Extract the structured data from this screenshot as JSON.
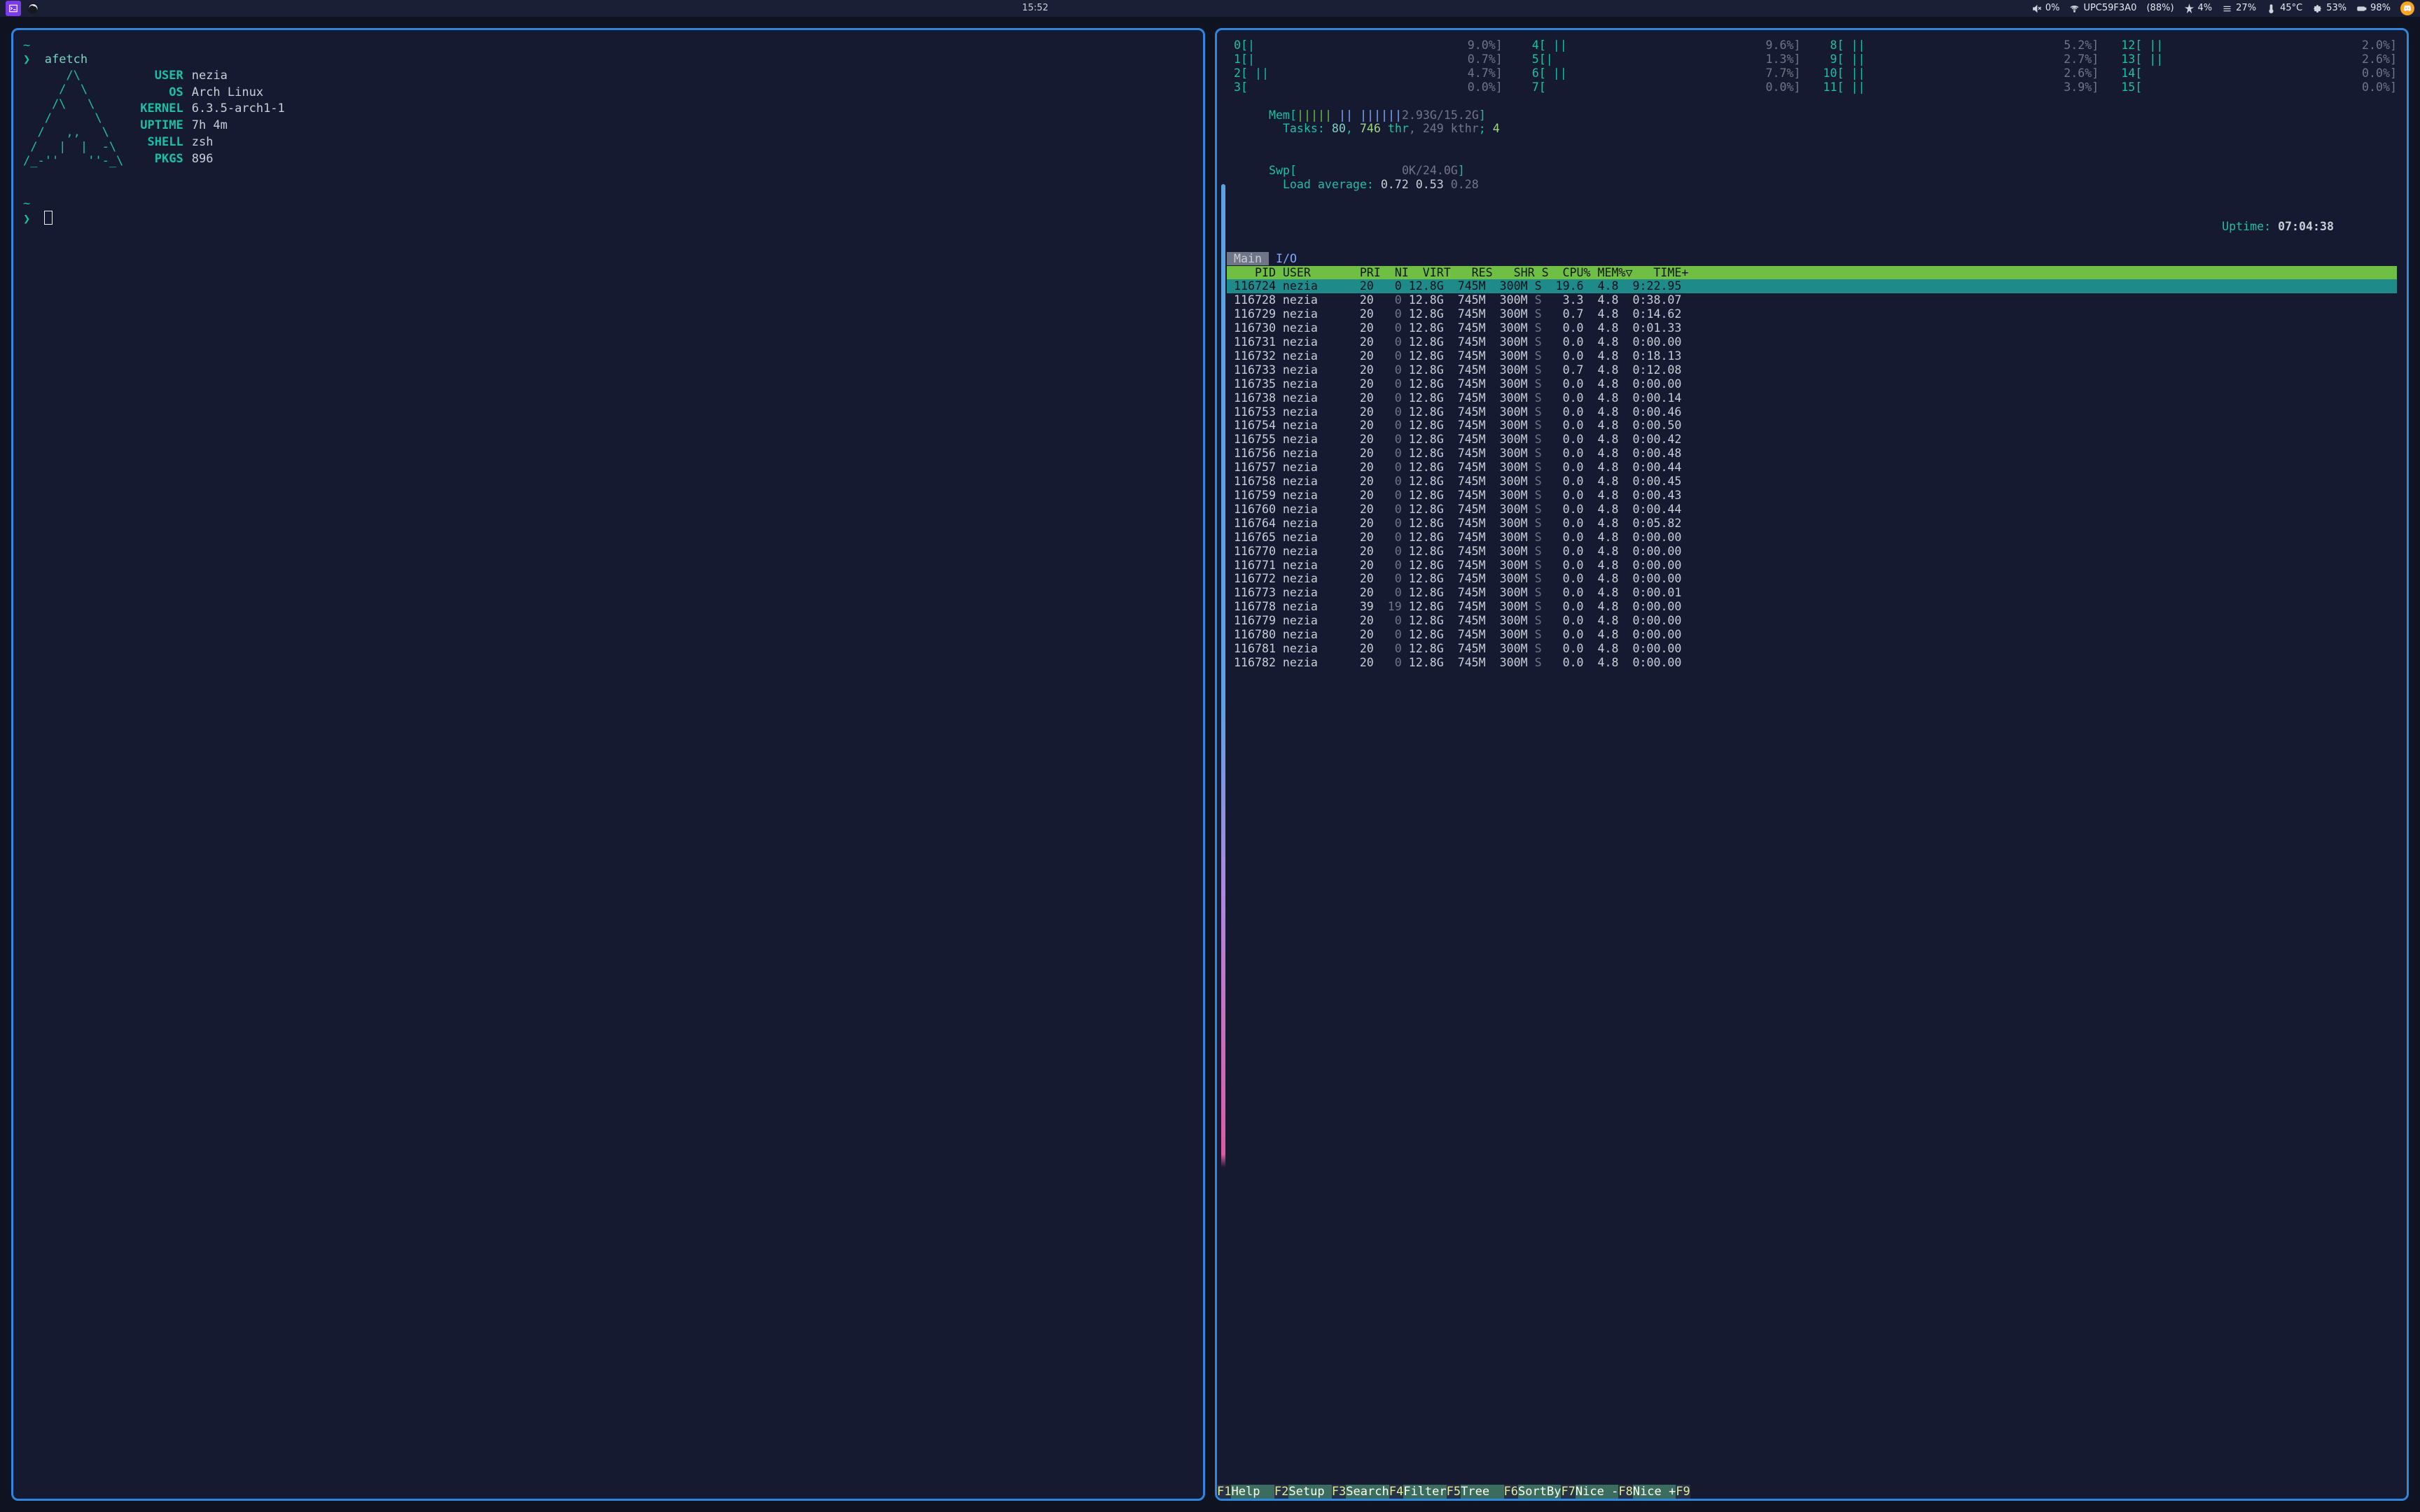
{
  "taskbar": {
    "time": "15:52",
    "volume": {
      "pct": "0%"
    },
    "wifi": {
      "ssid": "UPC59F3A0",
      "signal": "(88%)"
    },
    "notify": {
      "pct": "4%"
    },
    "hamburger": {
      "pct": "27%"
    },
    "thermo": {
      "temp": "45°C"
    },
    "gear": {
      "pct": "53%"
    },
    "battery": {
      "pct": "98%"
    }
  },
  "left_terminal": {
    "prompt_char": "❯",
    "tilde": "~",
    "cmd": "afetch",
    "logo": "      /\\\n     /  \\\n    /\\   \\\n   /      \\\n  /   ,,   \\\n /   |  |  -\\\n/_-''    ''-_\\",
    "rows": [
      {
        "k": "USER",
        "v": "nezia"
      },
      {
        "k": "OS",
        "v": "Arch Linux"
      },
      {
        "k": "KERNEL",
        "v": "6.3.5-arch1-1"
      },
      {
        "k": "UPTIME",
        "v": "7h 4m"
      },
      {
        "k": "SHELL",
        "v": "zsh"
      },
      {
        "k": "PKGS",
        "v": "896"
      }
    ]
  },
  "htop": {
    "cpus": [
      {
        "i": "0",
        "bar": "[|",
        "pct": "9.0%]"
      },
      {
        "i": "1",
        "bar": "[|",
        "pct": "0.7%]"
      },
      {
        "i": "2",
        "bar": "[ ||",
        "pct": "4.7%]"
      },
      {
        "i": "3",
        "bar": "[",
        "pct": "0.0%]"
      },
      {
        "i": "4",
        "bar": "[ ||",
        "pct": "9.6%]"
      },
      {
        "i": "5",
        "bar": "[|",
        "pct": "1.3%]"
      },
      {
        "i": "6",
        "bar": "[ ||",
        "pct": "7.7%]"
      },
      {
        "i": "7",
        "bar": "[",
        "pct": "0.0%]"
      },
      {
        "i": "8",
        "bar": "[ ||",
        "pct": "5.2%]"
      },
      {
        "i": "9",
        "bar": "[ ||",
        "pct": "2.7%]"
      },
      {
        "i": "10",
        "bar": "[ ||",
        "pct": "2.6%]"
      },
      {
        "i": "11",
        "bar": "[ ||",
        "pct": "3.9%]"
      },
      {
        "i": "12",
        "bar": "[ ||",
        "pct": "2.0%]"
      },
      {
        "i": "13",
        "bar": "[ ||",
        "pct": "2.6%]"
      },
      {
        "i": "14",
        "bar": "[",
        "pct": "0.0%]"
      },
      {
        "i": "15",
        "bar": "[",
        "pct": "0.0%]"
      }
    ],
    "mem": {
      "label": "Mem",
      "bars": "||||| || ||||||",
      "used": "2.93G",
      "total": "15.2G"
    },
    "swap": {
      "label": "Swp",
      "used": "0K",
      "total": "24.0G"
    },
    "tasks": {
      "label": "Tasks:",
      "procs": "80",
      "thr": "746",
      "thr_lbl": "thr",
      "kthr": "249",
      "kthr_lbl": "kthr",
      "run": "4"
    },
    "loadavg": {
      "label": "Load average:",
      "a": "0.72",
      "b": "0.53",
      "c": "0.28"
    },
    "uptime": {
      "label": "Uptime:",
      "v": "07:04:38"
    },
    "tabs": {
      "a": "Main",
      "b": "I/O"
    },
    "header": "    PID USER       PRI  NI  VIRT   RES   SHR S  CPU% MEM%▽   TIME+",
    "procs": [
      {
        "pid": "116724",
        "user": "nezia",
        "pri": "20",
        "ni": "0",
        "virt": "12.8G",
        "res": "745M",
        "shr": "300M",
        "s": "S",
        "cpu": "19.6",
        "mem": "4.8",
        "time": "9:22.95",
        "sel": true
      },
      {
        "pid": "116728",
        "user": "nezia",
        "pri": "20",
        "ni": "0",
        "virt": "12.8G",
        "res": "745M",
        "shr": "300M",
        "s": "S",
        "cpu": "3.3",
        "mem": "4.8",
        "time": "0:38.07"
      },
      {
        "pid": "116729",
        "user": "nezia",
        "pri": "20",
        "ni": "0",
        "virt": "12.8G",
        "res": "745M",
        "shr": "300M",
        "s": "S",
        "cpu": "0.7",
        "mem": "4.8",
        "time": "0:14.62"
      },
      {
        "pid": "116730",
        "user": "nezia",
        "pri": "20",
        "ni": "0",
        "virt": "12.8G",
        "res": "745M",
        "shr": "300M",
        "s": "S",
        "cpu": "0.0",
        "mem": "4.8",
        "time": "0:01.33"
      },
      {
        "pid": "116731",
        "user": "nezia",
        "pri": "20",
        "ni": "0",
        "virt": "12.8G",
        "res": "745M",
        "shr": "300M",
        "s": "S",
        "cpu": "0.0",
        "mem": "4.8",
        "time": "0:00.00"
      },
      {
        "pid": "116732",
        "user": "nezia",
        "pri": "20",
        "ni": "0",
        "virt": "12.8G",
        "res": "745M",
        "shr": "300M",
        "s": "S",
        "cpu": "0.0",
        "mem": "4.8",
        "time": "0:18.13"
      },
      {
        "pid": "116733",
        "user": "nezia",
        "pri": "20",
        "ni": "0",
        "virt": "12.8G",
        "res": "745M",
        "shr": "300M",
        "s": "S",
        "cpu": "0.7",
        "mem": "4.8",
        "time": "0:12.08"
      },
      {
        "pid": "116735",
        "user": "nezia",
        "pri": "20",
        "ni": "0",
        "virt": "12.8G",
        "res": "745M",
        "shr": "300M",
        "s": "S",
        "cpu": "0.0",
        "mem": "4.8",
        "time": "0:00.00"
      },
      {
        "pid": "116738",
        "user": "nezia",
        "pri": "20",
        "ni": "0",
        "virt": "12.8G",
        "res": "745M",
        "shr": "300M",
        "s": "S",
        "cpu": "0.0",
        "mem": "4.8",
        "time": "0:00.14"
      },
      {
        "pid": "116753",
        "user": "nezia",
        "pri": "20",
        "ni": "0",
        "virt": "12.8G",
        "res": "745M",
        "shr": "300M",
        "s": "S",
        "cpu": "0.0",
        "mem": "4.8",
        "time": "0:00.46"
      },
      {
        "pid": "116754",
        "user": "nezia",
        "pri": "20",
        "ni": "0",
        "virt": "12.8G",
        "res": "745M",
        "shr": "300M",
        "s": "S",
        "cpu": "0.0",
        "mem": "4.8",
        "time": "0:00.50"
      },
      {
        "pid": "116755",
        "user": "nezia",
        "pri": "20",
        "ni": "0",
        "virt": "12.8G",
        "res": "745M",
        "shr": "300M",
        "s": "S",
        "cpu": "0.0",
        "mem": "4.8",
        "time": "0:00.42"
      },
      {
        "pid": "116756",
        "user": "nezia",
        "pri": "20",
        "ni": "0",
        "virt": "12.8G",
        "res": "745M",
        "shr": "300M",
        "s": "S",
        "cpu": "0.0",
        "mem": "4.8",
        "time": "0:00.48"
      },
      {
        "pid": "116757",
        "user": "nezia",
        "pri": "20",
        "ni": "0",
        "virt": "12.8G",
        "res": "745M",
        "shr": "300M",
        "s": "S",
        "cpu": "0.0",
        "mem": "4.8",
        "time": "0:00.44"
      },
      {
        "pid": "116758",
        "user": "nezia",
        "pri": "20",
        "ni": "0",
        "virt": "12.8G",
        "res": "745M",
        "shr": "300M",
        "s": "S",
        "cpu": "0.0",
        "mem": "4.8",
        "time": "0:00.45"
      },
      {
        "pid": "116759",
        "user": "nezia",
        "pri": "20",
        "ni": "0",
        "virt": "12.8G",
        "res": "745M",
        "shr": "300M",
        "s": "S",
        "cpu": "0.0",
        "mem": "4.8",
        "time": "0:00.43"
      },
      {
        "pid": "116760",
        "user": "nezia",
        "pri": "20",
        "ni": "0",
        "virt": "12.8G",
        "res": "745M",
        "shr": "300M",
        "s": "S",
        "cpu": "0.0",
        "mem": "4.8",
        "time": "0:00.44"
      },
      {
        "pid": "116764",
        "user": "nezia",
        "pri": "20",
        "ni": "0",
        "virt": "12.8G",
        "res": "745M",
        "shr": "300M",
        "s": "S",
        "cpu": "0.0",
        "mem": "4.8",
        "time": "0:05.82"
      },
      {
        "pid": "116765",
        "user": "nezia",
        "pri": "20",
        "ni": "0",
        "virt": "12.8G",
        "res": "745M",
        "shr": "300M",
        "s": "S",
        "cpu": "0.0",
        "mem": "4.8",
        "time": "0:00.00"
      },
      {
        "pid": "116770",
        "user": "nezia",
        "pri": "20",
        "ni": "0",
        "virt": "12.8G",
        "res": "745M",
        "shr": "300M",
        "s": "S",
        "cpu": "0.0",
        "mem": "4.8",
        "time": "0:00.00"
      },
      {
        "pid": "116771",
        "user": "nezia",
        "pri": "20",
        "ni": "0",
        "virt": "12.8G",
        "res": "745M",
        "shr": "300M",
        "s": "S",
        "cpu": "0.0",
        "mem": "4.8",
        "time": "0:00.00"
      },
      {
        "pid": "116772",
        "user": "nezia",
        "pri": "20",
        "ni": "0",
        "virt": "12.8G",
        "res": "745M",
        "shr": "300M",
        "s": "S",
        "cpu": "0.0",
        "mem": "4.8",
        "time": "0:00.00"
      },
      {
        "pid": "116773",
        "user": "nezia",
        "pri": "20",
        "ni": "0",
        "virt": "12.8G",
        "res": "745M",
        "shr": "300M",
        "s": "S",
        "cpu": "0.0",
        "mem": "4.8",
        "time": "0:00.01"
      },
      {
        "pid": "116778",
        "user": "nezia",
        "pri": "39",
        "ni": "19",
        "virt": "12.8G",
        "res": "745M",
        "shr": "300M",
        "s": "S",
        "cpu": "0.0",
        "mem": "4.8",
        "time": "0:00.00"
      },
      {
        "pid": "116779",
        "user": "nezia",
        "pri": "20",
        "ni": "0",
        "virt": "12.8G",
        "res": "745M",
        "shr": "300M",
        "s": "S",
        "cpu": "0.0",
        "mem": "4.8",
        "time": "0:00.00"
      },
      {
        "pid": "116780",
        "user": "nezia",
        "pri": "20",
        "ni": "0",
        "virt": "12.8G",
        "res": "745M",
        "shr": "300M",
        "s": "S",
        "cpu": "0.0",
        "mem": "4.8",
        "time": "0:00.00"
      },
      {
        "pid": "116781",
        "user": "nezia",
        "pri": "20",
        "ni": "0",
        "virt": "12.8G",
        "res": "745M",
        "shr": "300M",
        "s": "S",
        "cpu": "0.0",
        "mem": "4.8",
        "time": "0:00.00"
      },
      {
        "pid": "116782",
        "user": "nezia",
        "pri": "20",
        "ni": "0",
        "virt": "12.8G",
        "res": "745M",
        "shr": "300M",
        "s": "S",
        "cpu": "0.0",
        "mem": "4.8",
        "time": "0:00.00"
      }
    ],
    "fn": [
      {
        "k": "F1",
        "l": "Help  "
      },
      {
        "k": "F2",
        "l": "Setup "
      },
      {
        "k": "F3",
        "l": "Search"
      },
      {
        "k": "F4",
        "l": "Filter"
      },
      {
        "k": "F5",
        "l": "Tree  "
      },
      {
        "k": "F6",
        "l": "SortBy"
      },
      {
        "k": "F7",
        "l": "Nice -"
      },
      {
        "k": "F8",
        "l": "Nice +"
      },
      {
        "k": "F9",
        "l": ""
      }
    ]
  }
}
